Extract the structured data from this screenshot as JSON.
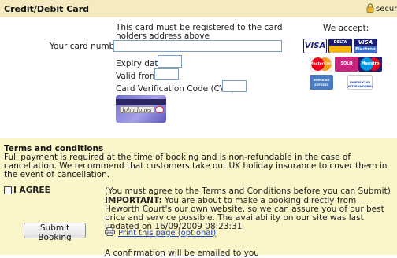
{
  "card_section": {
    "title": "Credit/Debit Card",
    "secure_text": "secur",
    "registration_note": "This card must be registered to the card holders address above",
    "card_number_label": "Your card number",
    "card_number_value": "",
    "expiry_label": "Expiry date",
    "valid_from_label": "Valid from",
    "cvc_label": "Card Verification Code (CVC)",
    "signature_sample": "John Jones",
    "accepted_label": "We accept:",
    "accepted_cards": [
      {
        "name": "visa-logo",
        "text": "VISA"
      },
      {
        "name": "visa-delta-logo",
        "text": "DELTA"
      },
      {
        "name": "visa-electron-logo",
        "text_top": "VISA",
        "text_bottom": "Electron"
      },
      {
        "name": "mastercard-logo",
        "text": "MasterCard"
      },
      {
        "name": "solo-logo",
        "text": "SOLO"
      },
      {
        "name": "maestro-logo",
        "text": "Maestro"
      },
      {
        "name": "american-express-logo",
        "text": "AMERICAN EXPRESS"
      },
      {
        "name": "diners-club-logo",
        "text": "DINERS CLUB INTERNATIONAL"
      }
    ]
  },
  "terms_section": {
    "title": "Terms and conditions",
    "body": "Full payment is required at the time of booking and is non-refundable in the case of cancellation. We recommend that customers take out UK holiday insurance to cover them in the event of cancellation.",
    "agree_label": "I AGREE",
    "must_agree_note": "(You must agree to the Terms and Conditions before you can Submit)",
    "important_label": "IMPORTANT:",
    "important_text": " You are about to make a booking directly from Heworth Court's our own website, so we can assure you of our best price and service possible.  The availability on our site was last updated on 16/09/2009 08:23:31",
    "submit_label": "Submit Booking",
    "print_link": "Print this page (optional)",
    "confirmation_text": "A confirmation will be emailed to you"
  },
  "colors": {
    "header_bg": "#f4ecc0",
    "terms_bg": "#fbf6c9",
    "link": "#1a3fbf",
    "input_border": "#7aa0c8"
  }
}
